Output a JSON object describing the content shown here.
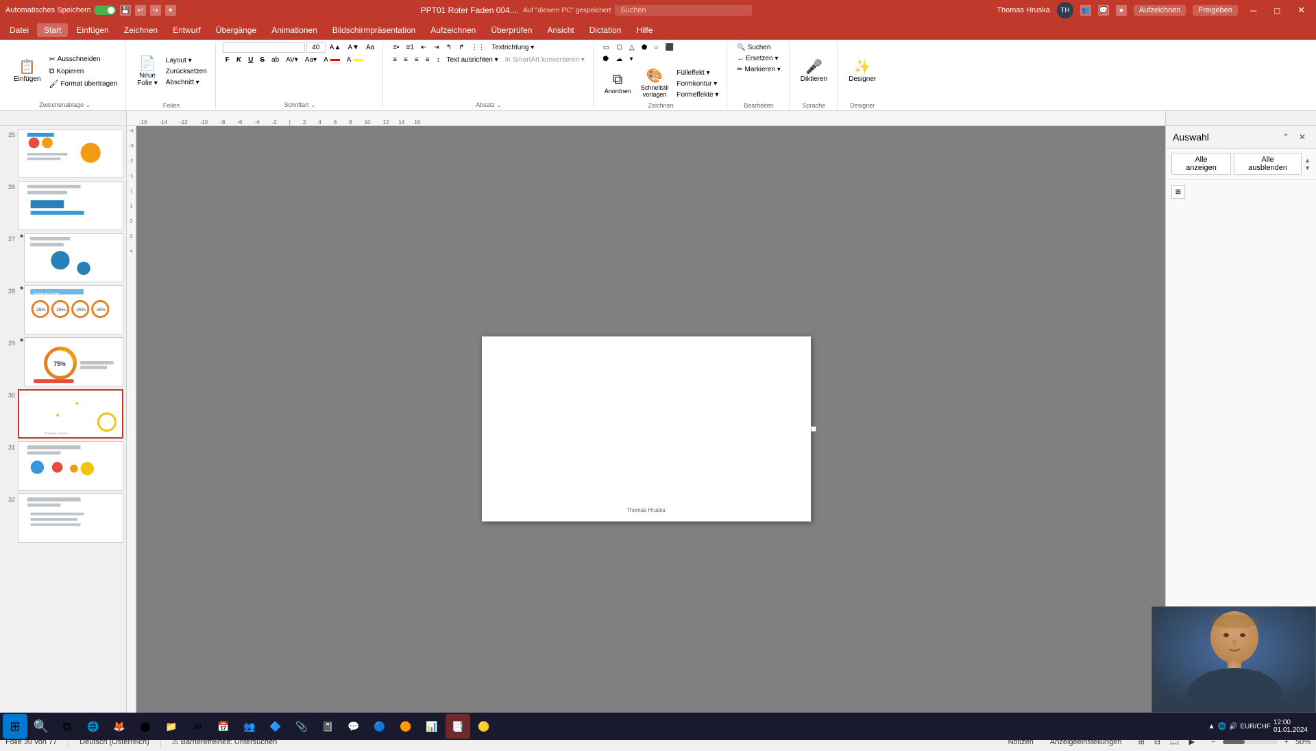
{
  "titlebar": {
    "autosave_label": "Automatisches Speichern",
    "title": "PPT01 Roter Faden 004....",
    "save_location": "Auf \"diesem PC\" gespeichert",
    "search_placeholder": "Suchen",
    "user_name": "Thomas Hruska",
    "user_initials": "TH",
    "minimize": "─",
    "restore": "□",
    "close": "✕"
  },
  "menubar": {
    "items": [
      "Datei",
      "Start",
      "Einfügen",
      "Zeichnen",
      "Entwurf",
      "Übergänge",
      "Animationen",
      "Bildschirmpräsentation",
      "Aufzeichnen",
      "Überprüfen",
      "Ansicht",
      "Dictation",
      "Hilfe"
    ]
  },
  "ribbon": {
    "groups": {
      "zwischenablage": {
        "label": "Zwischenablage",
        "buttons": [
          "Einfügen",
          "Ausschneiden",
          "Kopieren",
          "Format übertragen"
        ]
      },
      "folien": {
        "label": "Folien",
        "buttons": [
          "Neue Folie",
          "Layout",
          "Zurücksetzen",
          "Abschnitt"
        ]
      },
      "schriftart": {
        "label": "Schriftart",
        "font_name": "",
        "font_size": "40",
        "buttons": [
          "F",
          "K",
          "U",
          "S",
          "ab",
          "A"
        ]
      },
      "absatz": {
        "label": "Absatz",
        "buttons": [
          "list",
          "num-list",
          "align",
          "indent"
        ]
      },
      "zeichnen": {
        "label": "Zeichnen",
        "shapes": []
      },
      "bearbeiten": {
        "label": "Bearbeiten",
        "buttons": [
          "Suchen",
          "Ersetzen",
          "Markieren"
        ]
      },
      "sprache": {
        "label": "Sprache",
        "buttons": [
          "Diktieren"
        ]
      },
      "designer": {
        "label": "Designer",
        "buttons": [
          "Designer"
        ]
      }
    }
  },
  "slides": [
    {
      "number": "25",
      "star": false,
      "active": false
    },
    {
      "number": "26",
      "star": false,
      "active": false
    },
    {
      "number": "27",
      "star": true,
      "active": false
    },
    {
      "number": "28",
      "star": true,
      "active": false
    },
    {
      "number": "29",
      "star": true,
      "active": false
    },
    {
      "number": "30",
      "star": false,
      "active": true
    },
    {
      "number": "31",
      "star": false,
      "active": false
    },
    {
      "number": "32",
      "star": false,
      "active": false
    }
  ],
  "current_slide": {
    "footer_text": "Thomas Hruska"
  },
  "right_panel": {
    "title": "Auswahl",
    "btn_show_all": "Alle anzeigen",
    "btn_hide_all": "Alle ausblenden"
  },
  "statusbar": {
    "slide_info": "Folie 30 von 77",
    "language": "Deutsch (Österreich)",
    "accessibility": "Barrierefreiheit: Untersuchen",
    "notes_btn": "Notizen",
    "display_settings_btn": "Anzeigeeinstellungen"
  },
  "taskbar": {
    "currency": "EUR/CHF",
    "apps": [
      "⊞",
      "🔍",
      "⚙",
      "🦊",
      "🟢",
      "📁",
      "🎵",
      "📋",
      "📱",
      "💛",
      "🔵",
      "🟣",
      "📧",
      "💬",
      "🔷",
      "📎",
      "🟠",
      "💻",
      "🟡",
      "📊"
    ]
  }
}
